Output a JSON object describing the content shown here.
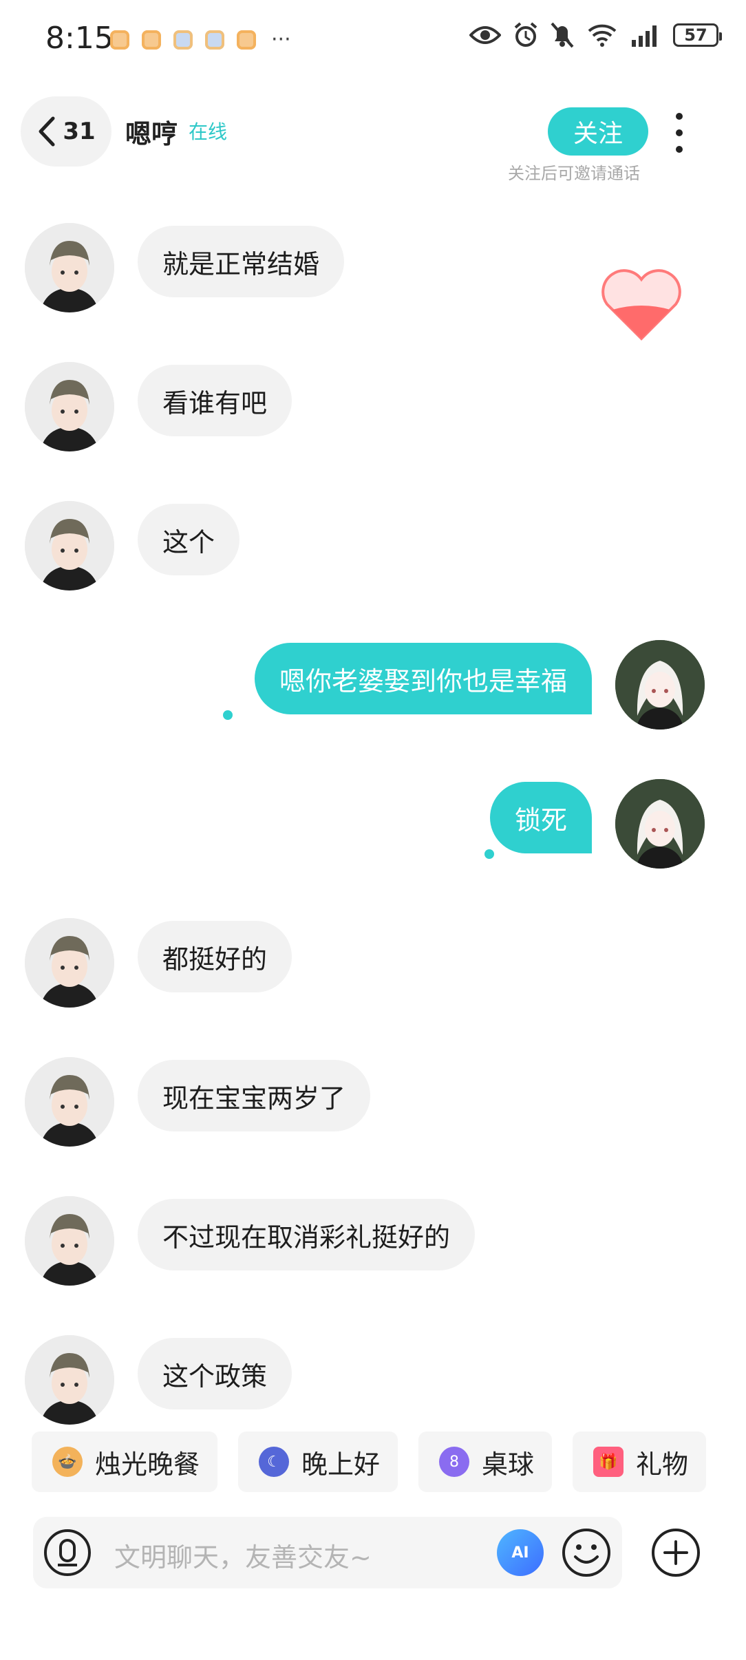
{
  "status_bar": {
    "time": "8:15",
    "more": "···",
    "battery": "57"
  },
  "header": {
    "back_count": "31",
    "contact_name": "嗯哼",
    "online_status": "在线",
    "follow_label": "关注",
    "follow_hint": "关注后可邀请通话"
  },
  "messages": [
    {
      "side": "left",
      "text": "就是正常结婚"
    },
    {
      "side": "left",
      "text": "看谁有吧"
    },
    {
      "side": "left",
      "text": "这个"
    },
    {
      "side": "right",
      "text": "嗯你老婆娶到你也是幸福"
    },
    {
      "side": "right",
      "text": "锁死"
    },
    {
      "side": "left",
      "text": "都挺好的"
    },
    {
      "side": "left",
      "text": "现在宝宝两岁了"
    },
    {
      "side": "left",
      "text": "不过现在取消彩礼挺好的"
    },
    {
      "side": "left",
      "text": "这个政策"
    }
  ],
  "quick_actions": [
    {
      "label": "烛光晚餐",
      "icon": "candle-dinner-icon",
      "color": "#f0a64a"
    },
    {
      "label": "晚上好",
      "icon": "moon-icon",
      "color": "#5567d8"
    },
    {
      "label": "桌球",
      "icon": "billiard-ball-icon",
      "color": "#8a6cf0"
    },
    {
      "label": "礼物",
      "icon": "gift-icon",
      "color": "#ff5f7e"
    }
  ],
  "input": {
    "placeholder": "文明聊天，友善交友~",
    "ai_label": "AI"
  },
  "colors": {
    "accent": "#2fd0cf",
    "bubble_left": "#f2f2f2"
  }
}
